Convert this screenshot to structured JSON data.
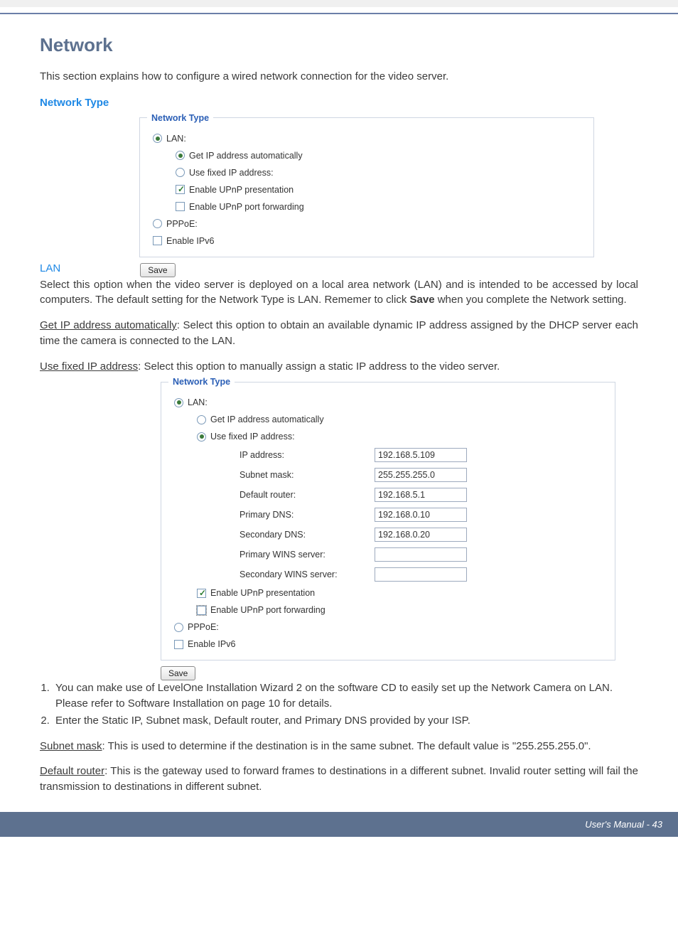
{
  "header": {
    "title": "Network",
    "intro": "This section explains how to configure a wired network connection for the video server."
  },
  "network_type": {
    "heading": "Network Type",
    "lan_label": "LAN",
    "panel1": {
      "legend": "Network Type",
      "lan_radio": "LAN:",
      "get_ip": "Get IP address automatically",
      "use_fixed": "Use fixed IP address:",
      "upnp_presentation": "Enable UPnP presentation",
      "upnp_port": "Enable UPnP port forwarding",
      "pppoe": "PPPoE:",
      "ipv6": "Enable IPv6",
      "save": "Save"
    },
    "para_lan": "Select this option when the video server is deployed on a local area network (LAN) and is intended to be accessed by local computers. The default setting for the Network Type is LAN. Rememer to click Save when you complete the Network setting.",
    "para_get_ip_label": "Get IP address automatically",
    "para_get_ip_rest": ": Select this option to obtain an available dynamic IP address assigned by the DHCP server each time the camera is connected to the LAN.",
    "para_use_fixed_label": "Use fixed IP address",
    "para_use_fixed_rest": ": Select this option to manually assign a static IP address to the video server.",
    "panel2": {
      "legend": "Network Type",
      "lan_radio": "LAN:",
      "get_ip": "Get IP address automatically",
      "use_fixed": "Use fixed IP address:",
      "fields": {
        "ip_label": "IP address:",
        "ip_value": "192.168.5.109",
        "subnet_label": "Subnet mask:",
        "subnet_value": "255.255.255.0",
        "router_label": "Default router:",
        "router_value": "192.168.5.1",
        "pdns_label": "Primary DNS:",
        "pdns_value": "192.168.0.10",
        "sdns_label": "Secondary DNS:",
        "sdns_value": "192.168.0.20",
        "pwins_label": "Primary WINS server:",
        "pwins_value": "",
        "swins_label": "Secondary WINS server:",
        "swins_value": ""
      },
      "upnp_presentation": "Enable UPnP presentation",
      "upnp_port": "Enable UPnP port forwarding",
      "pppoe": "PPPoE:",
      "ipv6": "Enable IPv6",
      "save": "Save"
    },
    "list": {
      "item1": "You can make use of LevelOne Installation Wizard 2 on the software CD to easily set up the Network Camera on LAN. Please refer to Software Installation on page 10 for details.",
      "item2": "Enter the Static IP, Subnet mask, Default router, and Primary DNS provided by your ISP."
    },
    "para_subnet_label": "Subnet mask",
    "para_subnet_rest": ": This is used to determine if the destination is in the same subnet. The default value is \"255.255.255.0\".",
    "para_router_label": "Default router",
    "para_router_rest": ": This is the gateway used to forward frames to destinations in a different subnet. Invalid router setting will fail the transmission to destinations in different subnet."
  },
  "footer": {
    "text": "User's Manual - 43"
  }
}
